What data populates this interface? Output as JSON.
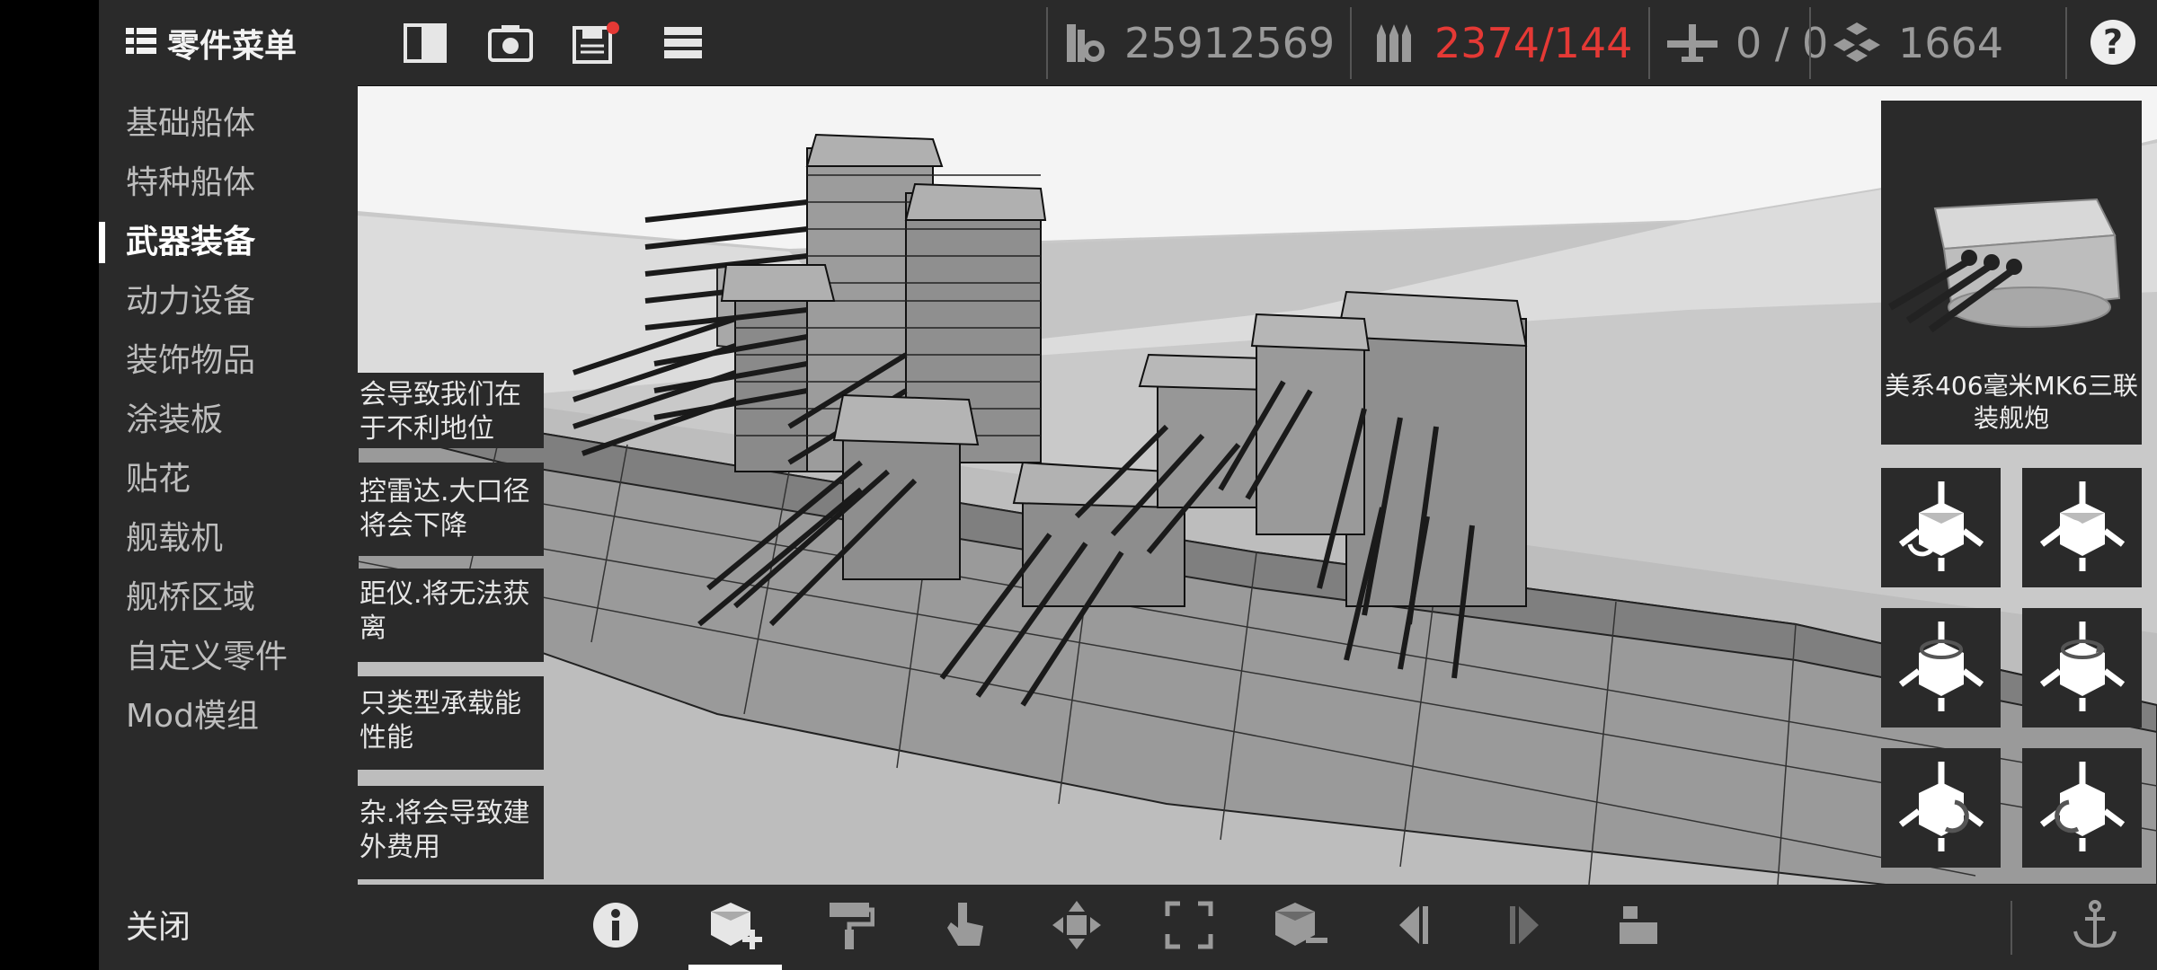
{
  "menu": {
    "title": "零件菜单",
    "items": [
      {
        "label": "基础船体"
      },
      {
        "label": "特种船体"
      },
      {
        "label": "武器装备"
      },
      {
        "label": "动力设备"
      },
      {
        "label": "装饰物品"
      },
      {
        "label": "涂装板"
      },
      {
        "label": "贴花"
      },
      {
        "label": "舰载机"
      },
      {
        "label": "舰桥区域"
      },
      {
        "label": "自定义零件"
      },
      {
        "label": "Mod模组"
      }
    ],
    "active": "武器装备",
    "close_label": "关闭"
  },
  "topbar": {
    "icons": [
      "split-view-icon",
      "camera-icon",
      "save-icon",
      "list-menu-icon"
    ],
    "stats": {
      "cost": "25912569",
      "ammo": "2374/144",
      "aircraft": "0 / 0",
      "parts": "1664"
    },
    "ammo_color": "#e53935",
    "help": "?"
  },
  "cards": [
    {
      "line1": "会导致我们在",
      "line2": "于不利地位"
    },
    {
      "line1": "控雷达.大口径",
      "line2": "将会下降"
    },
    {
      "line1": "距仪.将无法获",
      "line2": "离"
    },
    {
      "line1": "只类型承载能",
      "line2": "性能"
    },
    {
      "line1": "杂.将会导致建",
      "line2": "外费用"
    }
  ],
  "preview": {
    "name_line1": "美系406毫米MK6三联",
    "name_line2": "装舰炮"
  },
  "rotate_buttons": [
    "rotate-x-ccw-icon",
    "rotate-x-cw-icon",
    "rotate-y-ccw-icon",
    "rotate-y-cw-icon",
    "rotate-z-ccw-icon",
    "rotate-z-cw-icon"
  ],
  "bottombar": {
    "icons": [
      "info-icon",
      "add-part-icon",
      "paint-roller-icon",
      "touch-select-icon",
      "move-icon",
      "scale-icon",
      "remove-part-icon",
      "previous-icon",
      "next-icon",
      "layers-icon",
      "anchor-icon"
    ],
    "active": "add-part-icon"
  }
}
